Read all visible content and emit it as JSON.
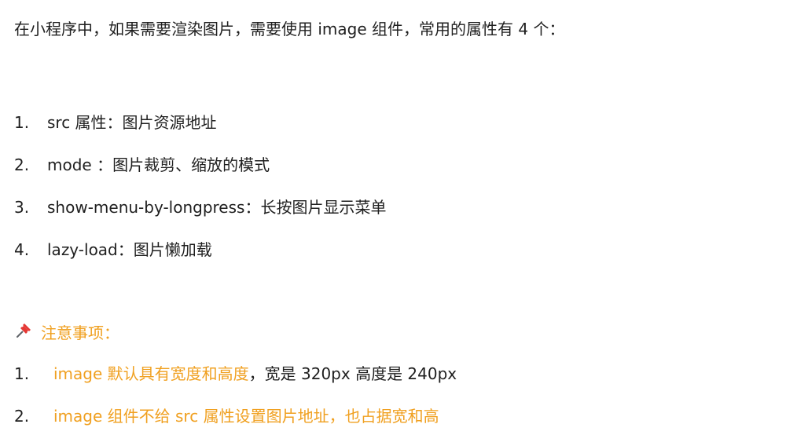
{
  "intro": "在小程序中，如果需要渲染图片，需要使用 image 组件，常用的属性有 4 个：",
  "list": [
    {
      "num": "1.",
      "text": "src 属性：图片资源地址"
    },
    {
      "num": "2.",
      "text": "mode ：图片裁剪、缩放的模式"
    },
    {
      "num": "3.",
      "text": "show-menu-by-longpress：长按图片显示菜单"
    },
    {
      "num": "4.",
      "text": "lazy-load：图片懒加载"
    }
  ],
  "notes_title": "注意事项：",
  "notes": [
    {
      "num": "1.",
      "highlight": "image 默认具有宽度和高度",
      "text": "，宽是 320px 高度是 240px"
    },
    {
      "num": "2.",
      "highlight": "image 组件不给 src 属性设置图片地址，也占据宽和高",
      "text": ""
    }
  ],
  "colors": {
    "text": "#1f1f1f",
    "highlight": "#f0a020",
    "pin": "#e53935"
  },
  "icons": {
    "pin": "pushpin-icon"
  }
}
